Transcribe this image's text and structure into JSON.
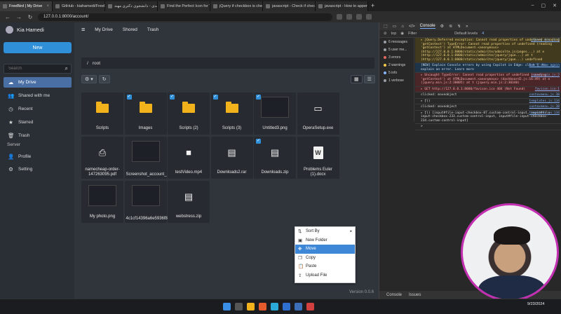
{
  "browser": {
    "tabs": [
      {
        "label": "FreeBird | My Drive",
        "active": true
      },
      {
        "label": "GitHub - kiahamedi/FreeBird: F",
        "active": false
      },
      {
        "label": "کیا حامدی - دانشجوی دکتری مهند",
        "active": false
      },
      {
        "label": "Find the Perfect Icon for Your F",
        "active": false
      },
      {
        "label": "jQuery if checkbox is checked",
        "active": false
      },
      {
        "label": "javascript - Check if checkbox is",
        "active": false
      },
      {
        "label": "javascript - How to append som",
        "active": false
      }
    ],
    "url": "127.0.0.1:8000/account/"
  },
  "sidebar": {
    "user_name": "Kia Hamedi",
    "new_button": "New",
    "search_placeholder": "Search",
    "items": [
      {
        "label": "My Drive",
        "icon": "cloud-icon",
        "glyph": "☁",
        "active": true
      },
      {
        "label": "Shared with me",
        "icon": "users-icon",
        "glyph": "👥",
        "active": false
      },
      {
        "label": "Recent",
        "icon": "clock-icon",
        "glyph": "◷",
        "active": false
      },
      {
        "label": "Starred",
        "icon": "star-icon",
        "glyph": "★",
        "active": false
      },
      {
        "label": "Trash",
        "icon": "trash-icon",
        "glyph": "🗑",
        "active": false
      }
    ],
    "server_section": "Server",
    "server_items": [
      {
        "label": "Profile",
        "icon": "user-icon",
        "glyph": "👤"
      },
      {
        "label": "Setting",
        "icon": "gear-icon",
        "glyph": "⚙"
      }
    ]
  },
  "main": {
    "top_nav": [
      "My Drive",
      "Shored",
      "Trash"
    ],
    "breadcrumb": "root",
    "files": [
      {
        "name": "Scripts",
        "kind": "folder",
        "checked": false
      },
      {
        "name": "Images",
        "kind": "folder",
        "checked": true
      },
      {
        "name": "Scripts (2)",
        "kind": "folder",
        "checked": true
      },
      {
        "name": "Scripts (3)",
        "kind": "folder",
        "checked": true
      },
      {
        "name": "Untitled3.png",
        "kind": "image",
        "checked": true
      },
      {
        "name": "OperaSetup.exe",
        "kind": "file",
        "checked": false
      },
      {
        "name": "namecheap-order-147263095.pdf",
        "kind": "pdf",
        "checked": false
      },
      {
        "name": "Screenshot_account_",
        "kind": "image",
        "checked": false
      },
      {
        "name": "testVideo.mp4",
        "kind": "video",
        "checked": false
      },
      {
        "name": "Downloads2.rar",
        "kind": "archive",
        "checked": false
      },
      {
        "name": "Downloads.zip",
        "kind": "archive",
        "checked": true
      },
      {
        "name": "Problems Euler (1).docx",
        "kind": "word",
        "checked": false
      },
      {
        "name": "My photo.png",
        "kind": "image",
        "checked": false
      },
      {
        "name": "4c1cf14396a6e5936f8",
        "kind": "image",
        "checked": false
      },
      {
        "name": "webstress.zip",
        "kind": "archive",
        "checked": false
      }
    ],
    "version": "Version 0.0.6"
  },
  "context_menu": {
    "items": [
      {
        "label": "Sort By",
        "icon": "sort-icon",
        "glyph": "⇅",
        "submenu": true,
        "highlighted": false
      },
      {
        "label": "New Folder",
        "icon": "folder-plus-icon",
        "glyph": "▣",
        "submenu": false,
        "highlighted": false
      },
      {
        "label": "Move",
        "icon": "move-icon",
        "glyph": "✥",
        "submenu": false,
        "highlighted": true
      },
      {
        "label": "Copy",
        "icon": "copy-icon",
        "glyph": "❐",
        "submenu": false,
        "highlighted": false
      },
      {
        "label": "Paste",
        "icon": "paste-icon",
        "glyph": "📋",
        "submenu": false,
        "highlighted": false
      },
      {
        "label": "Upload File",
        "icon": "upload-icon",
        "glyph": "⇪",
        "submenu": false,
        "highlighted": false
      }
    ]
  },
  "devtools": {
    "tabs": [
      "Console"
    ],
    "context": "top",
    "filter_placeholder": "Filter",
    "levels": "Default levels",
    "issue_count": "4",
    "sidebar": [
      {
        "label": "6 messages",
        "color": "#9aa0a6"
      },
      {
        "label": "5 user me...",
        "color": "#9aa0a6"
      },
      {
        "label": "3 errors",
        "color": "#e46962"
      },
      {
        "label": "2 warnings",
        "color": "#f2c94c"
      },
      {
        "label": "5 info",
        "color": "#8ab4f8"
      },
      {
        "label": "1 verbose",
        "color": "#9aa0a6"
      }
    ],
    "messages": [
      {
        "type": "warn",
        "text": "▸ jQuery.Deferred exception: Cannot read properties of undefined (reading 'getContext') TypeError: Cannot read properties of undefined (reading 'getContext') at HTMLDocument.<anonymous> (http://127.0.0.1:8000/static/adminlte/adminlte.js/pages...) at e (http://127.0.0.1:8000/static/adminlte/jquery/jque...) at t (http://127.0.0.1:8000/static/adminlte/jquery/jque...) undefined",
        "link": "jquery.min.js:2"
      },
      {
        "type": "info",
        "text": "[NEW] Explain Console errors by using Copilot in Edge: click ⓘ to explain an error. Learn more",
        "link": "Don't show again"
      },
      {
        "type": "err",
        "text": "▸ Uncaught TypeError: Cannot read properties of undefined (reading 'getContext') at HTMLDocument.<anonymous> (dashboard2.js:16:49) at e (jquery.min.js:2:30005) at t (jquery.min.js:2:30340)",
        "link": "jquery.min.js:2"
      },
      {
        "type": "err",
        "text": "▸ GET http://127.0.0.1:8000/favicon.ico 404 (Not Found)",
        "link": "favicon.ico:1"
      },
      {
        "type": "log",
        "text": "clicked: moveobject",
        "link": "contexmenu.js:38"
      },
      {
        "type": "log",
        "text": "▸ ƒ()",
        "link": "templates.js:134"
      },
      {
        "type": "log",
        "text": "clicked: moveobject",
        "link": "contexmenu.js:38"
      },
      {
        "type": "log",
        "text": "▸ ƒ() [input#file-input-checkbox-87.custom-control-input, input#file-input-checkbox-233.custom-control-input, input#file-input-checkbox-234.custom-control-input]",
        "link": "templates.js:134"
      },
      {
        "type": "log",
        "text": ">",
        "link": ""
      }
    ],
    "bottom_tabs": [
      "Console",
      "Issues"
    ]
  },
  "taskbar": {
    "clock_time": "",
    "clock_date": "9/23/2024"
  }
}
